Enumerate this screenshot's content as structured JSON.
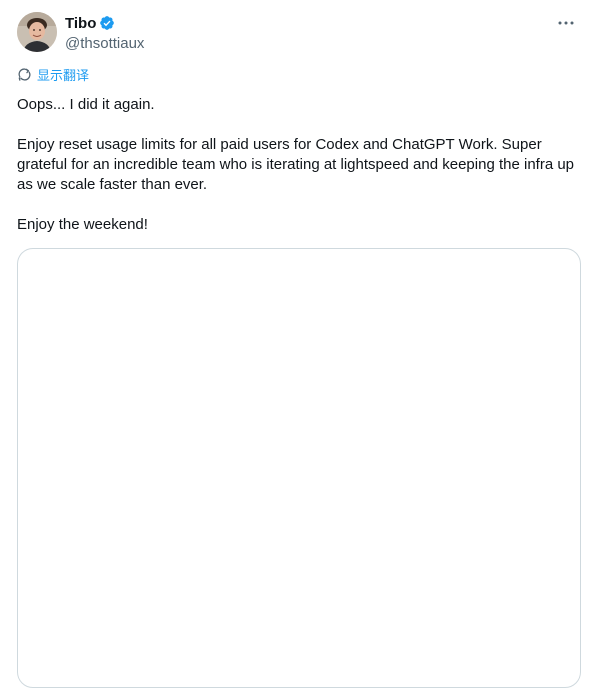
{
  "author": {
    "display_name": "Tibo",
    "handle": "@thsottiaux",
    "verified": true,
    "avatar_icon": "profile-photo"
  },
  "actions": {
    "more_icon": "more-horizontal-icon"
  },
  "translate": {
    "label": "显示翻译",
    "icon": "translate-icon"
  },
  "tweet": {
    "paragraphs": [
      "Oops... I did it again.",
      "Enjoy reset usage limits for all paid users for Codex and ChatGPT Work. Super grateful for an incredible team who is iterating at lightspeed and keeping the infra up as we scale faster than ever.",
      "Enjoy the weekend!"
    ]
  },
  "colors": {
    "accent": "#1d9bf0",
    "text": "#0f1419",
    "secondary_text": "#536471",
    "border": "#cfd9de"
  }
}
